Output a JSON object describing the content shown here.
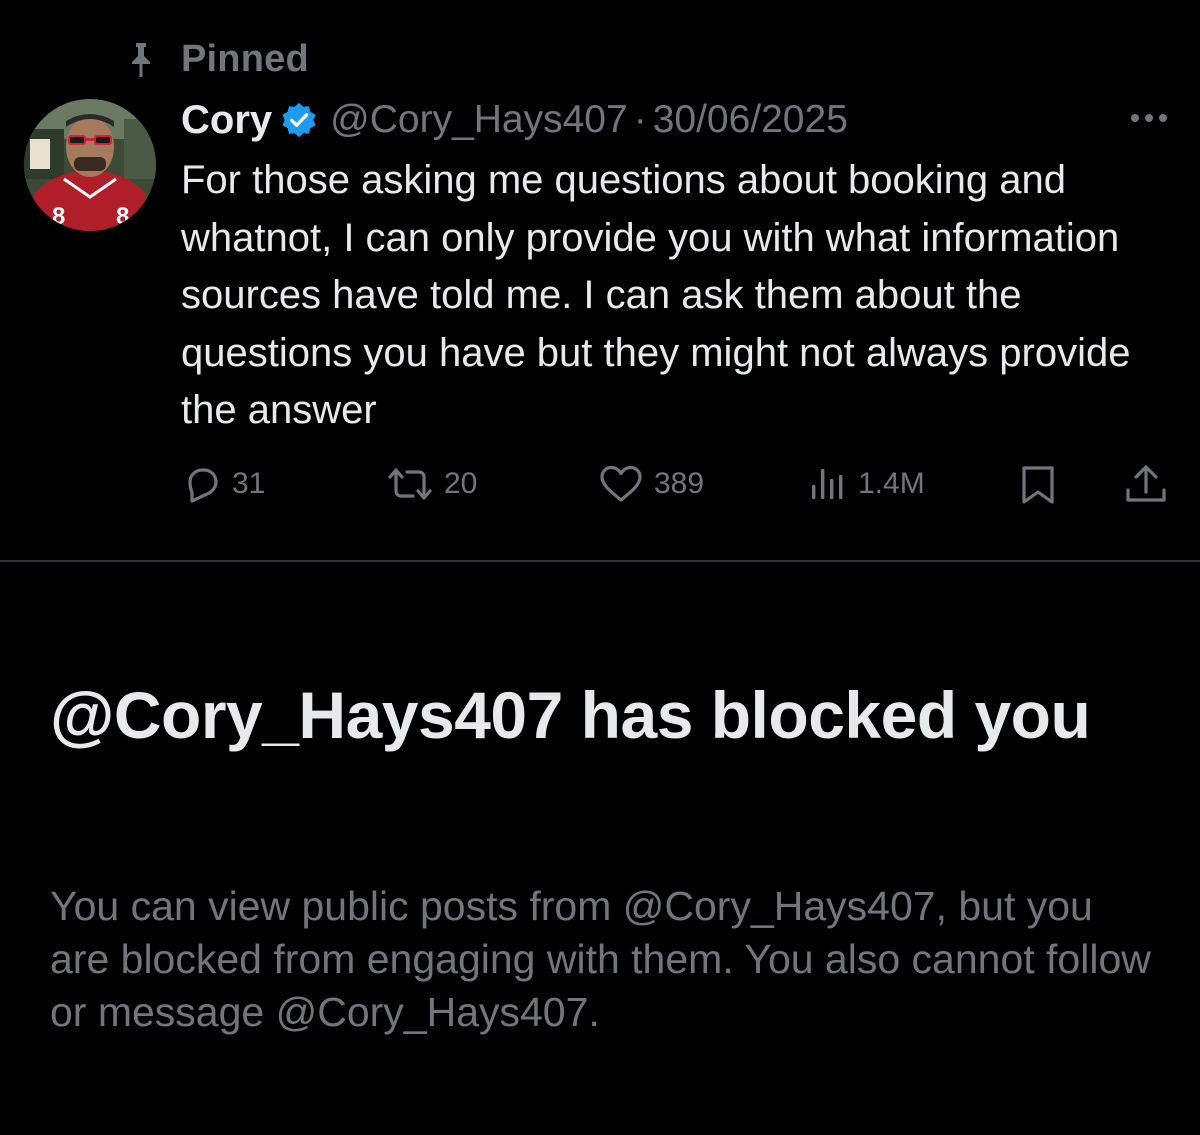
{
  "pinned": {
    "label": "Pinned",
    "icon": "pin-icon"
  },
  "tweet": {
    "author": {
      "display_name": "Cory",
      "verified_icon": "verified-badge-icon",
      "handle": "@Cory_Hays407",
      "avatar": "profile-photo"
    },
    "separator": "·",
    "date": "30/06/2025",
    "more_icon": "more-options-icon",
    "text": "For those asking me questions about booking and whatnot, I can only provide you with what information sources have told me. I can ask them about the questions you have but they might not always provide the answer",
    "actions": {
      "reply": {
        "icon": "reply-icon",
        "count": "31"
      },
      "retweet": {
        "icon": "retweet-icon",
        "count": "20"
      },
      "like": {
        "icon": "heart-icon",
        "count": "389"
      },
      "views": {
        "icon": "views-icon",
        "count": "1.4M"
      },
      "bookmark": {
        "icon": "bookmark-icon"
      },
      "share": {
        "icon": "share-icon"
      }
    }
  },
  "blocked_notice": {
    "title": "@Cory_Hays407 has blocked you",
    "description": "You can view public posts from @Cory_Hays407, but you are blocked from engaging with them. You also cannot follow or message @Cory_Hays407."
  },
  "colors": {
    "background": "#000000",
    "primary_text": "#e7e9ea",
    "secondary_text": "#71767b",
    "verified_blue": "#1d9bf0",
    "divider": "#2f3336"
  }
}
